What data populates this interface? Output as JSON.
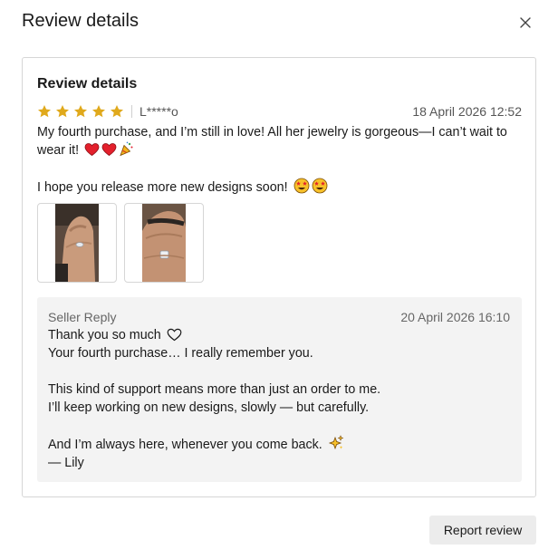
{
  "modal": {
    "title": "Review details"
  },
  "card": {
    "title": "Review details",
    "rating": 5,
    "rating_max": 5,
    "star_color": "#e0a91c",
    "username": "L*****o",
    "date": "18 April 2026 12:52",
    "review_lines": [
      "My fourth purchase, and I’m still in love! All her jewelry is gorgeous—I can’t wait to",
      "wear it!",
      "I hope you release more new designs soon!"
    ],
    "review_emojis": [
      "red-heart",
      "red-heart",
      "party-popper",
      "star-struck",
      "star-struck"
    ],
    "photos": [
      {
        "name": "review-photo-1"
      },
      {
        "name": "review-photo-2"
      }
    ]
  },
  "reply": {
    "label": "Seller Reply",
    "date": "20 April 2026 16:10",
    "lines": [
      "Thank you so much",
      "Your fourth purchase… I really remember you.",
      "This kind of support means more than just an order to me.",
      "I’ll keep working on new designs, slowly — but carefully.",
      "And I’m always here, whenever you come back.",
      "— Lily"
    ]
  },
  "actions": {
    "report_label": "Report review"
  }
}
